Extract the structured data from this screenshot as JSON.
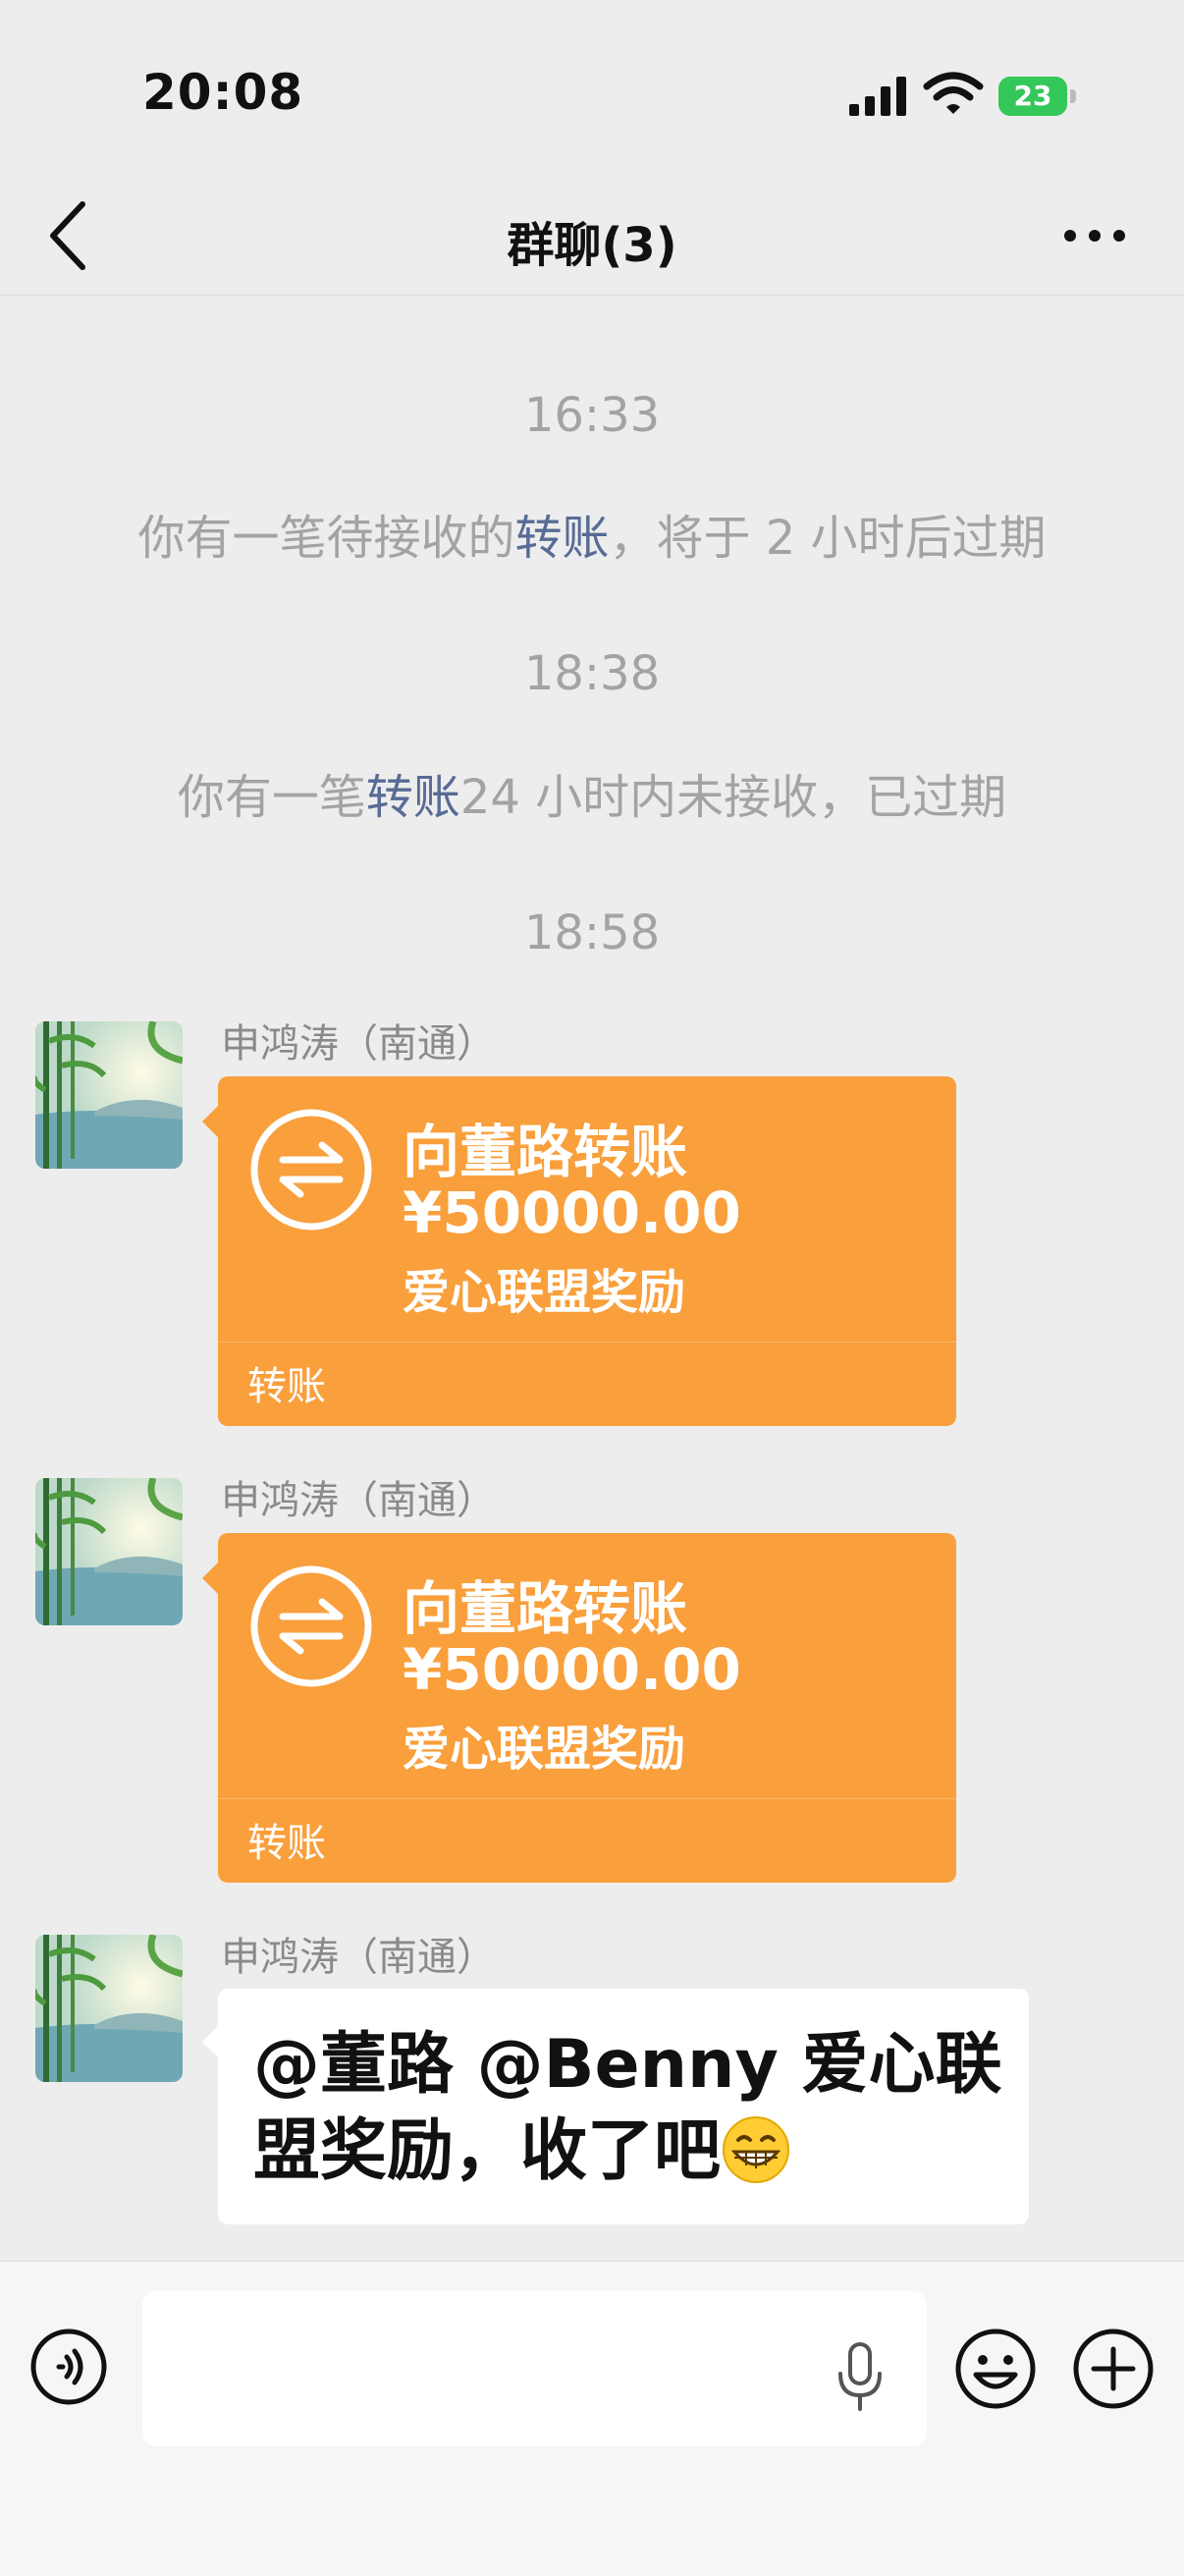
{
  "status_bar": {
    "time": "20:08",
    "battery": "23"
  },
  "nav": {
    "title": "群聊(3)"
  },
  "system": [
    {
      "time": "16:33",
      "text_pre": "你有一笔待接收的",
      "link": "转账",
      "text_post": "，将于 2 小时后过期"
    },
    {
      "time": "18:38",
      "text_pre": "你有一笔",
      "link": "转账",
      "text_post": "24 小时内未接收，已过期"
    },
    {
      "time": "18:58"
    }
  ],
  "messages": [
    {
      "sender": "申鸿涛（南通）",
      "type": "transfer",
      "title": "向董路转账",
      "amount": "¥50000.00",
      "note": "爱心联盟奖励",
      "label": "转账"
    },
    {
      "sender": "申鸿涛（南通）",
      "type": "transfer",
      "title": "向董路转账",
      "amount": "¥50000.00",
      "note": "爱心联盟奖励",
      "label": "转账"
    },
    {
      "sender": "申鸿涛（南通）",
      "type": "text",
      "text": "@董路 @Benny 爱心联盟奖励，收了吧"
    }
  ],
  "colors": {
    "transfer": "#f99f3c",
    "link": "#576b95",
    "background": "#ededed"
  },
  "icons": [
    "back-icon",
    "more-icon",
    "transfer-arrows-icon",
    "voice-icon",
    "mic-icon",
    "emoji-icon",
    "plus-icon",
    "grin-emoji-icon"
  ]
}
